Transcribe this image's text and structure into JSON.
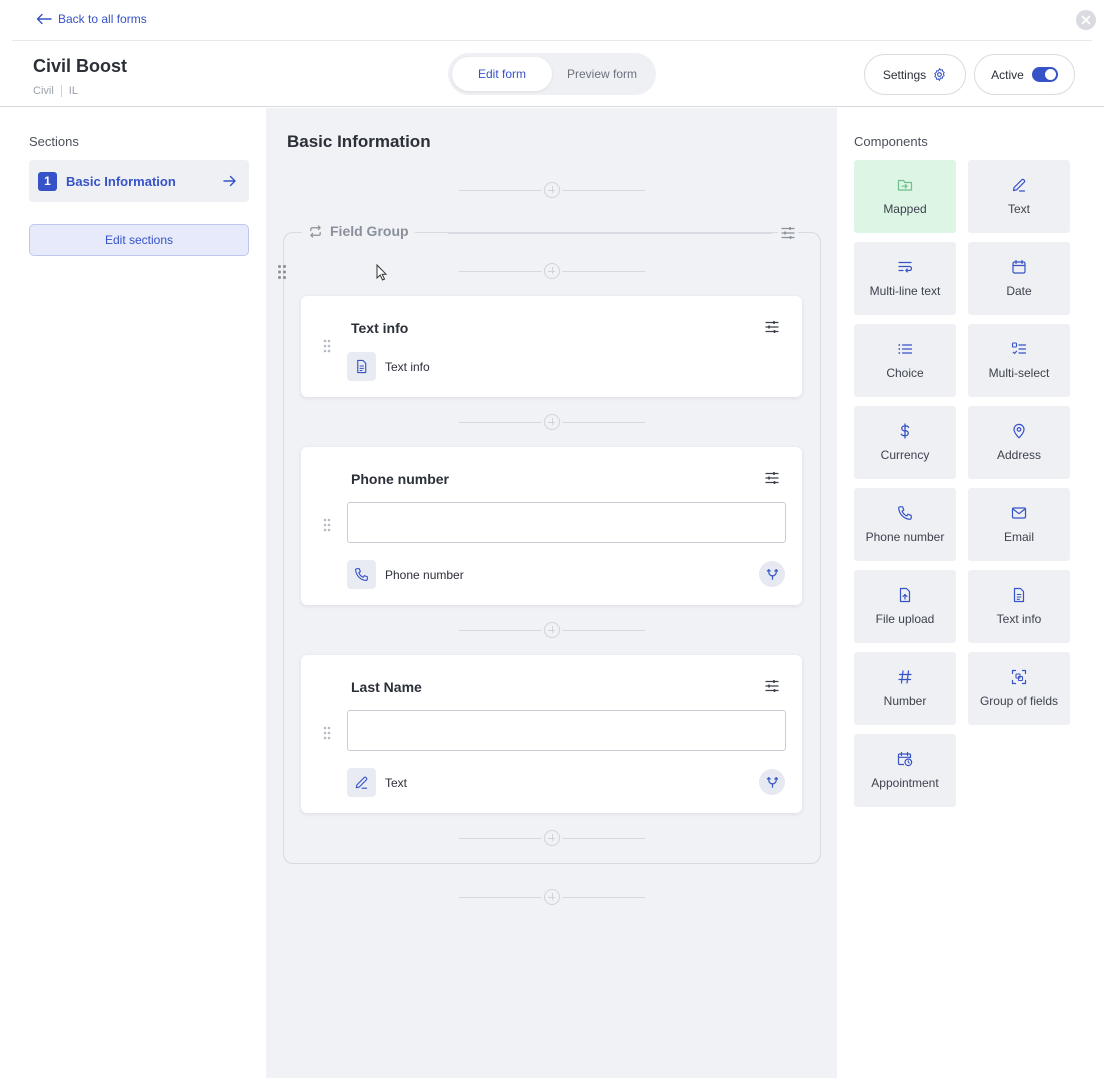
{
  "nav": {
    "back_label": "Back to all forms"
  },
  "form": {
    "title": "Civil Boost",
    "category": "Civil",
    "state": "IL"
  },
  "mode_toggle": {
    "edit_label": "Edit form",
    "preview_label": "Preview form",
    "selected": "Edit form"
  },
  "header_actions": {
    "settings_label": "Settings",
    "active_label": "Active",
    "active_on": true
  },
  "colors": {
    "accent": "#3652c7",
    "mapped_bg": "#dcf5e4",
    "canvas_bg": "#f1f2f6"
  },
  "sections": {
    "heading": "Sections",
    "items": [
      {
        "number": "1",
        "label": "Basic Information"
      }
    ],
    "edit_label": "Edit sections"
  },
  "canvas": {
    "section_title": "Basic Information",
    "group": {
      "label": "Field Group",
      "fields": [
        {
          "title": "Text info",
          "type_label": "Text info",
          "type_icon": "document-icon",
          "has_input": false
        },
        {
          "title": "Phone number",
          "type_label": "Phone number",
          "type_icon": "phone-icon",
          "has_input": true,
          "input_value": ""
        },
        {
          "title": "Last Name",
          "type_label": "Text",
          "type_icon": "pencil-icon",
          "has_input": true,
          "input_value": ""
        }
      ]
    }
  },
  "components": {
    "heading": "Components",
    "items": [
      {
        "label": "Mapped",
        "icon": "folder-arrow-icon"
      },
      {
        "label": "Text",
        "icon": "pencil-icon"
      },
      {
        "label": "Multi-line text",
        "icon": "multiline-icon"
      },
      {
        "label": "Date",
        "icon": "calendar-icon"
      },
      {
        "label": "Choice",
        "icon": "list-icon"
      },
      {
        "label": "Multi-select",
        "icon": "checklist-icon"
      },
      {
        "label": "Currency",
        "icon": "dollar-icon"
      },
      {
        "label": "Address",
        "icon": "location-pin-icon"
      },
      {
        "label": "Phone number",
        "icon": "phone-icon"
      },
      {
        "label": "Email",
        "icon": "envelope-icon"
      },
      {
        "label": "File upload",
        "icon": "file-upload-icon"
      },
      {
        "label": "Text info",
        "icon": "document-icon"
      },
      {
        "label": "Number",
        "icon": "hash-icon"
      },
      {
        "label": "Group of fields",
        "icon": "group-icon"
      },
      {
        "label": "Appointment",
        "icon": "calendar-clock-icon"
      }
    ]
  }
}
